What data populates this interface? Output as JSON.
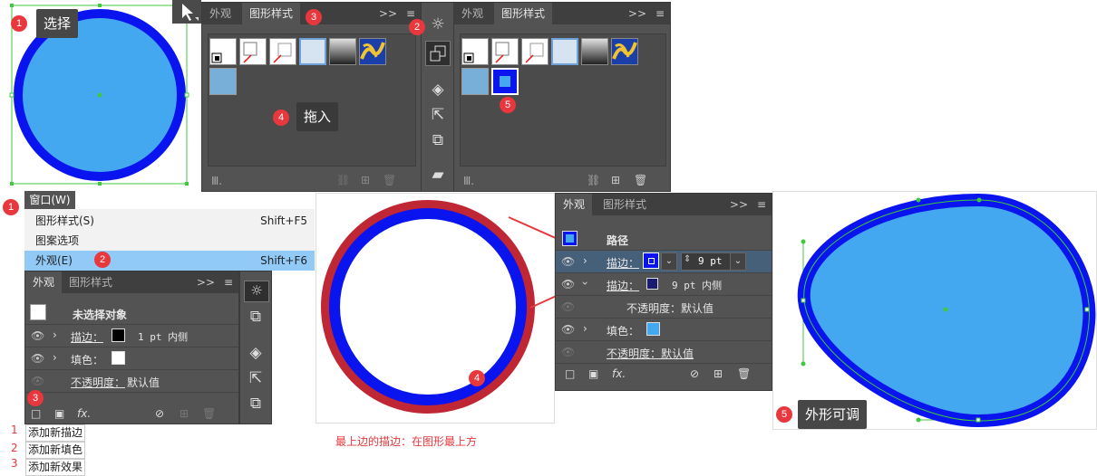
{
  "step1": {
    "select_label": "选择",
    "badge": "1"
  },
  "gs_panel_left": {
    "tab_appearance": "外观",
    "tab_graphic_styles": "图形样式",
    "badge": "3",
    "drag_label": "拖入",
    "drag_badge": "4",
    "menu_glyph": ">>",
    "lib_glyph": "Ⅲ."
  },
  "toolbar_badge": "2",
  "gs_panel_right": {
    "tab_appearance": "外观",
    "tab_graphic_styles": "图形样式",
    "new_style_badge": "5",
    "menu_glyph": ">>",
    "lib_glyph": "Ⅲ."
  },
  "window_menu": {
    "badge": "1",
    "title": "窗口(W)",
    "items": [
      {
        "label": "图形样式(S)",
        "shortcut": "Shift+F5"
      },
      {
        "label": "图案选项",
        "shortcut": ""
      },
      {
        "label": "外观(E)",
        "shortcut": "Shift+F6"
      }
    ],
    "highlight_badge": "2"
  },
  "appearance_left": {
    "tab_appearance": "外观",
    "tab_graphic_styles": "图形样式",
    "menu_glyph": ">>",
    "header": "未选择对象",
    "rows": [
      {
        "name": "描边：",
        "value": "1 pt  内侧"
      },
      {
        "name": "填色：",
        "value": ""
      },
      {
        "name": "不透明度：",
        "value": "默认值"
      }
    ],
    "badge": "3",
    "fx": "fx."
  },
  "legend": [
    {
      "num": "1",
      "label": "添加新描边"
    },
    {
      "num": "2",
      "label": "添加新填色"
    },
    {
      "num": "3",
      "label": "添加新效果"
    }
  ],
  "middle": {
    "badge": "4",
    "caption": "最上边的描边：在图形最上方"
  },
  "appearance_right": {
    "tab_appearance": "外观",
    "tab_graphic_styles": "图形样式",
    "menu_glyph": ">>",
    "header": "路径",
    "stroke1_label": "描边：",
    "stroke1_weight": "9 pt",
    "stroke2_label": "描边：",
    "stroke2_value": "9 pt  内侧",
    "opacity1": "不透明度：默认值",
    "fill_label": "填色：",
    "opacity2": "不透明度：默认值",
    "fx": "fx."
  },
  "shape_right": {
    "badge": "5",
    "label": "外形可调"
  },
  "colors": {
    "fill_blue": "#44a8f0",
    "stroke_blue": "#0a14ee",
    "stroke_red": "#c02735",
    "selection_green": "#3ec93e",
    "panel_bg": "#535353",
    "badge_red": "#e8383d"
  }
}
